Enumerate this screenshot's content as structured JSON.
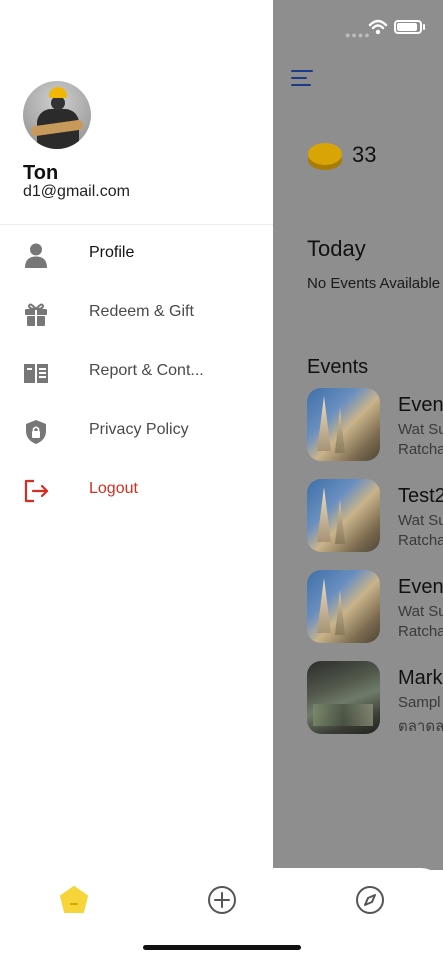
{
  "drawer": {
    "user": {
      "name": "Ton",
      "email": "d1@gmail.com"
    },
    "menu": [
      {
        "label": "Profile",
        "icon": "person-icon"
      },
      {
        "label": "Redeem & Gift",
        "icon": "gift-icon"
      },
      {
        "label": "Report & Cont...",
        "icon": "book-icon"
      },
      {
        "label": "Privacy Policy",
        "icon": "shield-lock-icon"
      },
      {
        "label": "Logout",
        "icon": "logout-icon"
      }
    ]
  },
  "background": {
    "coin_count": "33",
    "today_title": "Today",
    "no_events_text": "No Events Available",
    "events_title": "Events",
    "events": [
      {
        "title": "Even",
        "line1": "Wat Su",
        "line2": "Ratcha"
      },
      {
        "title": "Test2",
        "line1": "Wat Su",
        "line2": "Ratcha"
      },
      {
        "title": "Even",
        "line1": "Wat Su",
        "line2": "Ratcha"
      },
      {
        "title": "Mark",
        "line1": "Sampl",
        "line2": "ตลาดล"
      }
    ]
  },
  "colors": {
    "accent_blue": "#1f3a8a",
    "logout_red": "#d92c20",
    "coin_gold": "#d9a406",
    "home_tab_yellow": "#f7d43a",
    "overlay_gray": "#8e8e8e"
  },
  "tabs": [
    {
      "name": "home",
      "icon": "home-pentagon-icon"
    },
    {
      "name": "add",
      "icon": "plus-circle-icon"
    },
    {
      "name": "explore",
      "icon": "compass-icon"
    }
  ]
}
